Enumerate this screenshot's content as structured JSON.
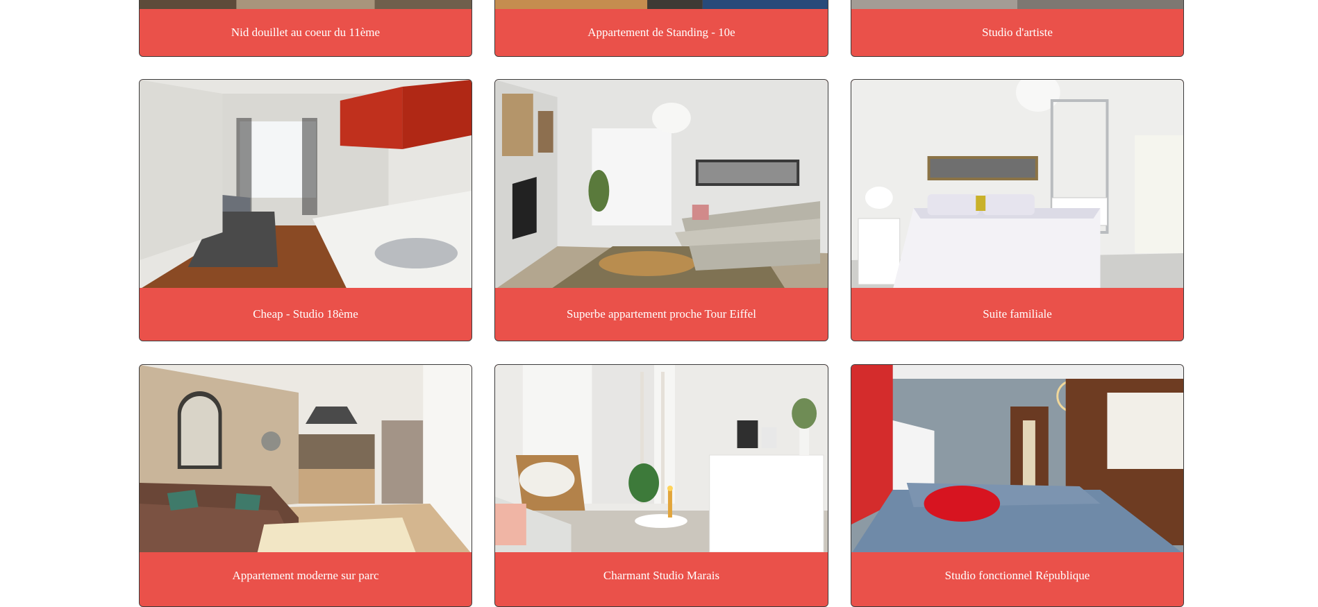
{
  "listings": [
    {
      "title": "Nid douillet au coeur du 11ème",
      "photo": "apartment-photo-top-left"
    },
    {
      "title": "Appartement de Standing - 10e",
      "photo": "apartment-photo-top-center"
    },
    {
      "title": "Studio d'artiste",
      "photo": "apartment-photo-top-right"
    },
    {
      "title": "Cheap - Studio 18ème",
      "photo": "kitchen-studio-photo"
    },
    {
      "title": "Superbe appartement proche Tour Eiffel",
      "photo": "living-room-photo"
    },
    {
      "title": "Suite familiale",
      "photo": "bedroom-photo"
    },
    {
      "title": "Appartement moderne sur parc",
      "photo": "brown-sofa-living-photo"
    },
    {
      "title": "Charmant Studio Marais",
      "photo": "white-living-corner-photo"
    },
    {
      "title": "Studio fonctionnel République",
      "photo": "blue-bedroom-photo"
    }
  ],
  "colors": {
    "caption_background": "#ea514a",
    "caption_text": "#ffffff",
    "card_border": "#3a3a3a",
    "page_background": "#ffffff"
  }
}
